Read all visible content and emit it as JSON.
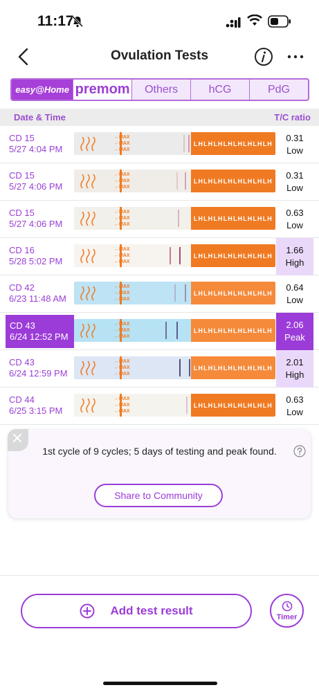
{
  "status_bar": {
    "time": "11:17"
  },
  "nav": {
    "title": "Ovulation Tests"
  },
  "brand_tabs": [
    {
      "label": "easy@Home"
    },
    {
      "label": "premom"
    },
    {
      "label": "Others"
    },
    {
      "label": "hCG"
    },
    {
      "label": "PdG"
    }
  ],
  "table": {
    "date_header": "Date & Time",
    "ratio_header": "T/C ratio",
    "rows": [
      {
        "cd": "CD 15",
        "datetime": "5/27 4:04 PM",
        "ratio": "0.31",
        "level": "Low"
      },
      {
        "cd": "CD 15",
        "datetime": "5/27 4:06 PM",
        "ratio": "0.31",
        "level": "Low"
      },
      {
        "cd": "CD 15",
        "datetime": "5/27 4:06 PM",
        "ratio": "0.63",
        "level": "Low"
      },
      {
        "cd": "CD 16",
        "datetime": "5/28 5:02 PM",
        "ratio": "1.66",
        "level": "High"
      },
      {
        "cd": "CD 42",
        "datetime": "6/23 11:48 AM",
        "ratio": "0.64",
        "level": "Low"
      },
      {
        "cd": "CD 43",
        "datetime": "6/24 12:52 PM",
        "ratio": "2.06",
        "level": "Peak"
      },
      {
        "cd": "CD 43",
        "datetime": "6/24 12:59 PM",
        "ratio": "2.01",
        "level": "High"
      },
      {
        "cd": "CD 44",
        "datetime": "6/25 3:15 PM",
        "ratio": "0.63",
        "level": "Low"
      }
    ]
  },
  "summary": {
    "text": "1st cycle of 9 cycles; 5 days of testing and peak found.",
    "share_label": "Share to Community"
  },
  "actions": {
    "add_label": "Add test result",
    "timer_label": "Timer"
  },
  "strip_text": {
    "max": "MAX",
    "handle": "LH"
  },
  "colors": {
    "accent": "#9b3cd9",
    "high_bg": "#ead8fa",
    "strip_orange": "#f07a22",
    "strip_blue": "#a9dcf3"
  }
}
